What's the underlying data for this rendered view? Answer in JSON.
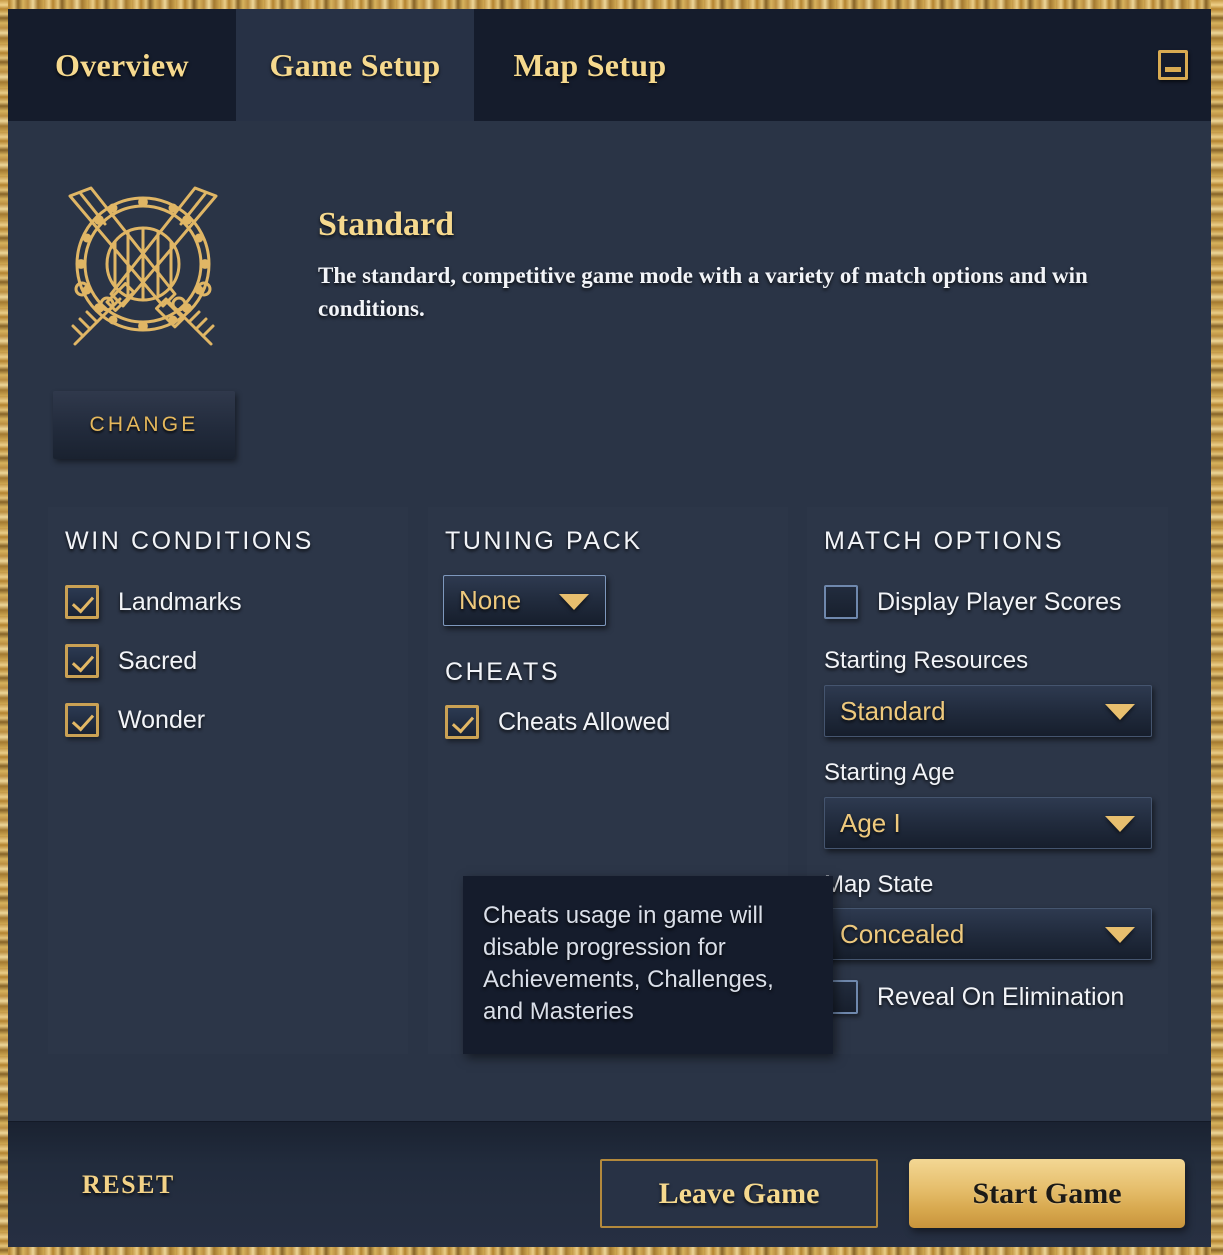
{
  "window": {
    "minimize_icon": "minimize-icon"
  },
  "tabs": [
    {
      "label": "Overview",
      "active": false
    },
    {
      "label": "Game Setup",
      "active": true
    },
    {
      "label": "Map Setup",
      "active": false
    }
  ],
  "mode": {
    "emblem_icon": "crossed-swords-shield-icon",
    "title": "Standard",
    "description": "The standard, competitive game mode with a variety of match options and win conditions.",
    "change_label": "CHANGE"
  },
  "win_conditions": {
    "title": "WIN CONDITIONS",
    "items": [
      {
        "label": "Landmarks",
        "checked": true
      },
      {
        "label": "Sacred",
        "checked": true
      },
      {
        "label": "Wonder",
        "checked": true
      }
    ]
  },
  "tuning_pack": {
    "title": "TUNING PACK",
    "dropdown": {
      "value": "None",
      "arrow_icon": "chevron-down-icon"
    },
    "cheats_title": "CHEATS",
    "cheats": {
      "label": "Cheats Allowed",
      "checked": true
    }
  },
  "match_options": {
    "title": "MATCH OPTIONS",
    "display_player_scores": {
      "label": "Display Player Scores",
      "checked": false
    },
    "starting_resources": {
      "label": "Starting Resources",
      "value": "Standard",
      "arrow_icon": "chevron-down-icon"
    },
    "starting_age": {
      "label": "Starting Age",
      "value": "Age I",
      "arrow_icon": "chevron-down-icon"
    },
    "map_state": {
      "label": "Map State",
      "value": "Concealed",
      "arrow_icon": "chevron-down-icon"
    },
    "reveal_on_elimination": {
      "label": "Reveal On Elimination",
      "checked": false
    }
  },
  "tooltip": {
    "text": "Cheats usage in game will disable progression for Achievements, Challenges, and Masteries"
  },
  "footer": {
    "reset_label": "RESET",
    "leave_label": "Leave Game",
    "start_label": "Start Game"
  },
  "colors": {
    "gold": "#e8bf6e",
    "gold_light": "#f6d98e",
    "panel_bg": "#2c3648",
    "page_bg": "#2a3446",
    "tabbar_bg": "#151c2c",
    "tooltip_bg": "#151c2c",
    "text_white": "#f2f4f8"
  }
}
